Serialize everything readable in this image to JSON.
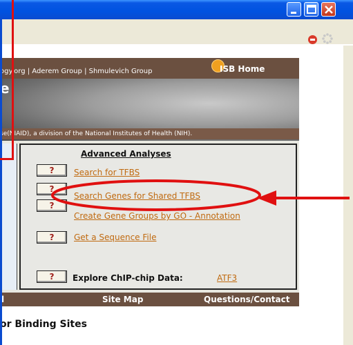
{
  "window": {
    "controls": [
      "minimize-icon",
      "maximize-icon",
      "close-icon"
    ]
  },
  "browser": {
    "icons": [
      "stop-icon",
      "throbber-icon"
    ]
  },
  "header": {
    "nav": {
      "items": [
        "ogy.org",
        "Aderem Group",
        "Shmulevich Group"
      ],
      "separator": "|"
    },
    "home_link": "ISB Home",
    "title_fragment": "e",
    "funding_text": "se(NIAID), a division of the National Institutes of Health (NIH)."
  },
  "advanced": {
    "title": "Advanced Analyses",
    "help_label": "?",
    "links": [
      "Search for TFBS",
      "Search Genes for Shared TFBS",
      "Create Gene Groups by GO - Annotation",
      "Get a Sequence File"
    ],
    "chip_label": "Explore ChIP-chip Data:",
    "chip_link": "ATF3"
  },
  "footer": {
    "left_fragment": "l",
    "site_map": "Site Map",
    "contact": "Questions/Contact"
  },
  "section_heading": "or Binding Sites",
  "annotation": {
    "color": "#e01010",
    "highlight_target": "Search Genes for Shared TFBS"
  },
  "colors": {
    "banner_brown": "#6b5040",
    "link_orange": "#c06a10",
    "xp_blue": "#0052e0"
  }
}
